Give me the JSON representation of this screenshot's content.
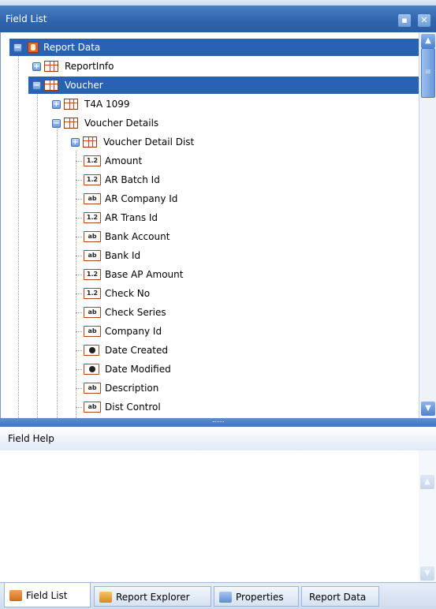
{
  "panel": {
    "title": "Field List",
    "pin_icon": "pin-icon",
    "close_icon": "close-icon"
  },
  "tree": {
    "root": "Report Data",
    "report_info": "ReportInfo",
    "voucher": "Voucher",
    "t4a": "T4A 1099",
    "voucher_details": "Voucher Details",
    "voucher_detail_dist": "Voucher Detail Dist",
    "fields": [
      {
        "label": "Amount",
        "type": "1.2"
      },
      {
        "label": "AR Batch Id",
        "type": "1.2"
      },
      {
        "label": "AR Company Id",
        "type": "ab"
      },
      {
        "label": "AR Trans Id",
        "type": "1.2"
      },
      {
        "label": "Bank Account",
        "type": "ab"
      },
      {
        "label": "Bank Id",
        "type": "ab"
      },
      {
        "label": "Base AP Amount",
        "type": "1.2"
      },
      {
        "label": "Check No",
        "type": "1.2"
      },
      {
        "label": "Check Series",
        "type": "ab"
      },
      {
        "label": "Company Id",
        "type": "ab"
      },
      {
        "label": "Date Created",
        "type": "date"
      },
      {
        "label": "Date Modified",
        "type": "date"
      },
      {
        "label": "Description",
        "type": "ab"
      },
      {
        "label": "Dist Control",
        "type": "ab"
      }
    ]
  },
  "help": {
    "title": "Field Help"
  },
  "tabs": [
    "Field List",
    "Report Explorer",
    "Properties",
    "Report Data"
  ],
  "colors": {
    "selection": "#2962b3",
    "accent": "#2f64ad"
  }
}
